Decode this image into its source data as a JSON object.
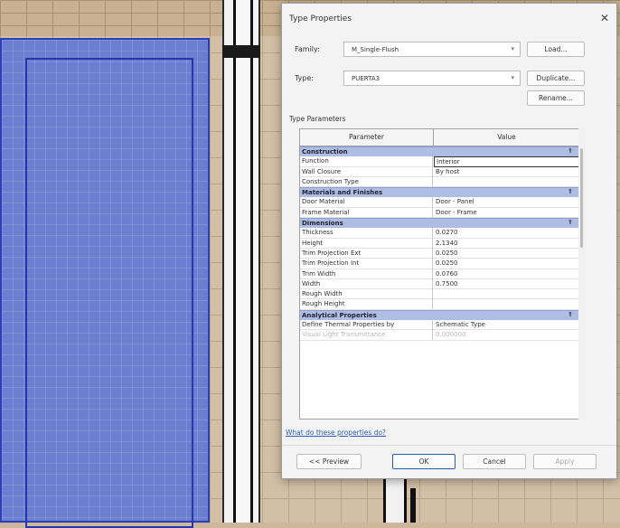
{
  "dialog": {
    "title": "Type Properties",
    "close_glyph": "✕",
    "family_label": "Family:",
    "family_value": "M_Single-Flush",
    "type_label": "Type:",
    "type_value": "PUERTA3",
    "load_button": "Load...",
    "duplicate_button": "Duplicate...",
    "rename_button": "Rename...",
    "type_parameters_label": "Type Parameters",
    "columns": {
      "parameter": "Parameter",
      "value": "Value"
    },
    "help_link": "What do these properties do?",
    "buttons": {
      "preview": "<< Preview",
      "ok": "OK",
      "cancel": "Cancel",
      "apply": "Apply"
    }
  },
  "groups": [
    {
      "name": "Construction",
      "rows": [
        {
          "name": "Function",
          "value": "Interior",
          "active": true
        },
        {
          "name": "Wall Closure",
          "value": "By host"
        },
        {
          "name": "Construction Type",
          "value": ""
        }
      ]
    },
    {
      "name": "Materials and Finishes",
      "rows": [
        {
          "name": "Door Material",
          "value": "Door - Panel"
        },
        {
          "name": "Frame Material",
          "value": "Door - Frame"
        }
      ]
    },
    {
      "name": "Dimensions",
      "rows": [
        {
          "name": "Thickness",
          "value": "0.0270"
        },
        {
          "name": "Height",
          "value": "2.1340"
        },
        {
          "name": "Trim Projection Ext",
          "value": "0.0250"
        },
        {
          "name": "Trim Projection Int",
          "value": "0.0250"
        },
        {
          "name": "Trim Width",
          "value": "0.0760"
        },
        {
          "name": "Width",
          "value": "0.7500"
        },
        {
          "name": "Rough Width",
          "value": ""
        },
        {
          "name": "Rough Height",
          "value": ""
        }
      ]
    },
    {
      "name": "Analytical Properties",
      "rows": [
        {
          "name": "Define Thermal Properties by",
          "value": "Schematic Type"
        },
        {
          "name": "Visual Light Transmittance",
          "value": "0.000000",
          "dim": true
        }
      ]
    }
  ],
  "colors": {
    "group_header": "#aebde3",
    "selection_fill": "#6b7fd0",
    "link": "#2a5db0"
  }
}
